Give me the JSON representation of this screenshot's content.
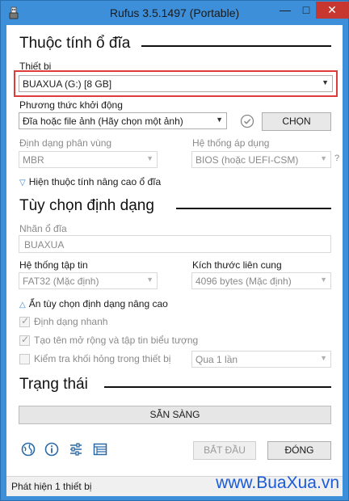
{
  "window": {
    "title": "Rufus 3.5.1497 (Portable)",
    "minimize": "—",
    "maximize": "□",
    "close": "✕"
  },
  "drive_properties": {
    "heading": "Thuộc tính ổ đĩa",
    "device_label": "Thiết bị",
    "device_value": "BUAXUA (G:) [8 GB]",
    "boot_selection_label": "Phương thức khởi động",
    "boot_selection_value": "Đĩa hoặc file ảnh (Hãy chọn một ảnh)",
    "select_button": "CHỌN",
    "partition_scheme_label": "Định dạng phân vùng",
    "partition_scheme_value": "MBR",
    "target_system_label": "Hệ thống áp dụng",
    "target_system_value": "BIOS (hoặc UEFI-CSM)",
    "target_help": "?",
    "advanced_toggle": "Hiện thuộc tính nâng cao ổ đĩa"
  },
  "format_options": {
    "heading": "Tùy chọn định dạng",
    "volume_label_label": "Nhãn ổ đĩa",
    "volume_label_value": "BUAXUA",
    "file_system_label": "Hệ thống tập tin",
    "file_system_value": "FAT32 (Mặc định)",
    "cluster_size_label": "Kích thước liên cung",
    "cluster_size_value": "4096 bytes (Mặc định)",
    "advanced_toggle": "Ẩn tùy chọn định dạng nâng cao",
    "quick_format_label": "Định dạng nhanh",
    "quick_format_checked": true,
    "extended_label_label": "Tạo tên mở rộng và tập tin biểu tượng",
    "extended_label_checked": true,
    "bad_blocks_label": "Kiểm tra khối hỏng trong thiết bị",
    "bad_blocks_checked": false,
    "passes_value": "Qua 1 lần"
  },
  "status": {
    "heading": "Trạng thái",
    "progress_text": "SẴN SÀNG",
    "start_button": "BẮT ĐẦU",
    "close_button": "ĐÓNG",
    "status_bar_text": "Phát hiện 1 thiết bị",
    "watermark": "www.BuaXua.vn"
  },
  "colors": {
    "titlebar": "#3c8fd8",
    "close_button": "#c7372f",
    "highlight": "#e03b3b",
    "watermark": "#1b5bd8"
  }
}
